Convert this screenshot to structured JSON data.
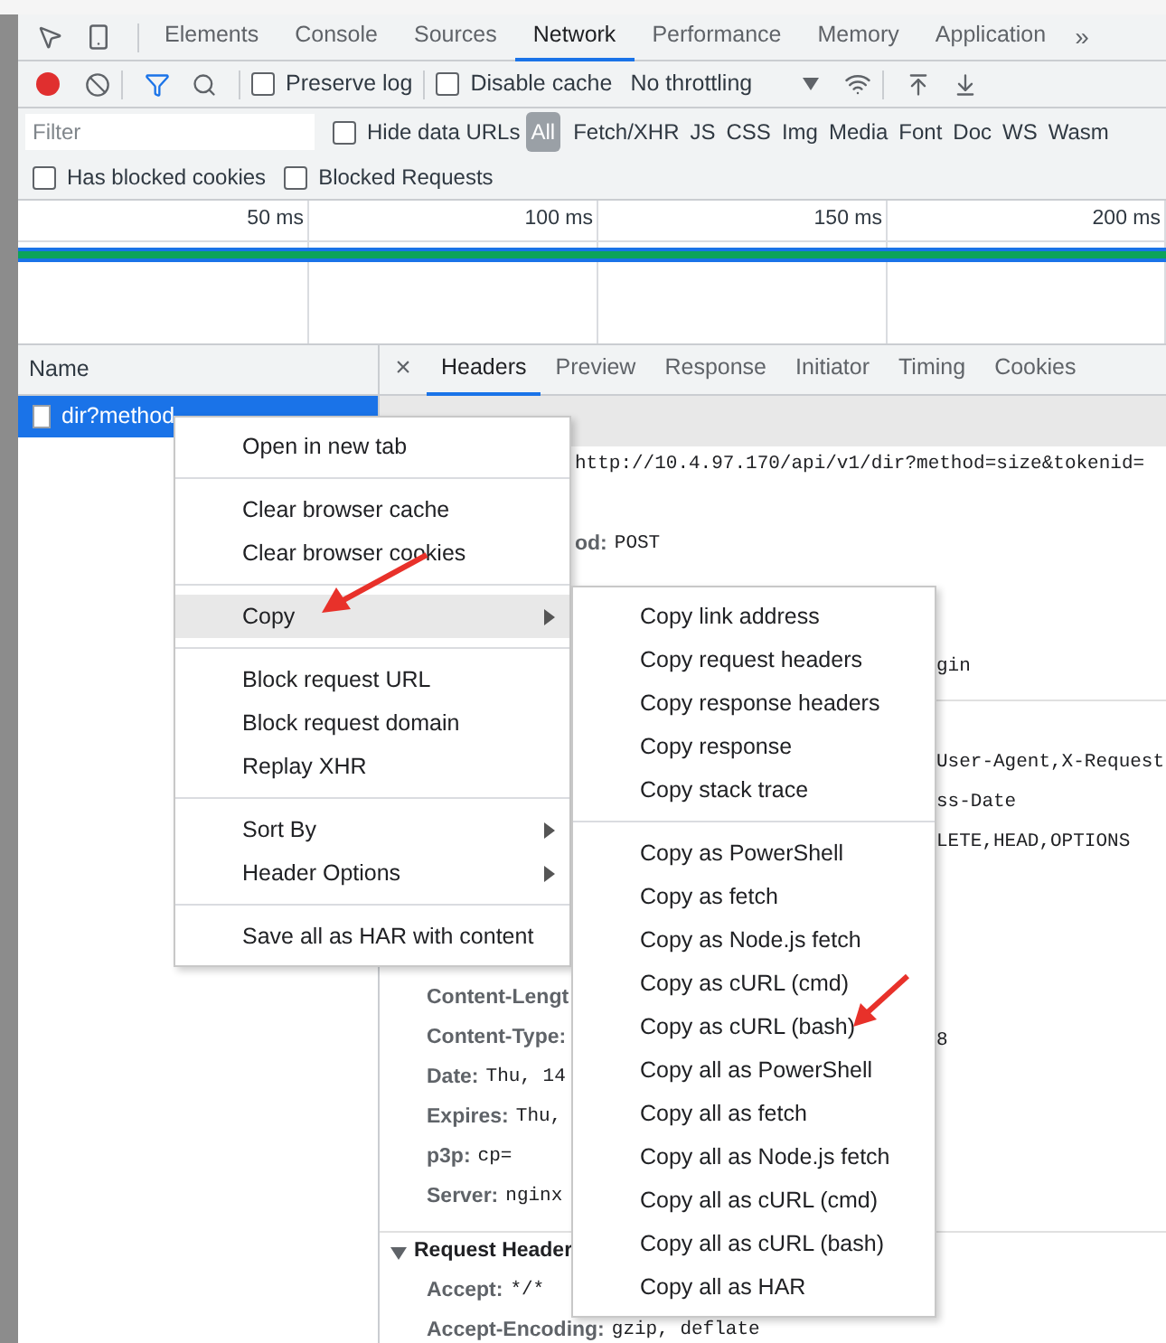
{
  "main_tabs": [
    {
      "label": "Elements",
      "selected": false
    },
    {
      "label": "Console",
      "selected": false
    },
    {
      "label": "Sources",
      "selected": false
    },
    {
      "label": "Network",
      "selected": true
    },
    {
      "label": "Performance",
      "selected": false
    },
    {
      "label": "Memory",
      "selected": false
    },
    {
      "label": "Application",
      "selected": false
    }
  ],
  "more_tabs": "»",
  "toolbar": {
    "recording": true,
    "preserve_log": {
      "label": "Preserve log",
      "checked": false
    },
    "disable_cache": {
      "label": "Disable cache",
      "checked": false
    },
    "throttling": "No throttling"
  },
  "filter": {
    "placeholder": "Filter",
    "hide_data_urls": {
      "label": "Hide data URLs",
      "checked": false
    },
    "types": [
      {
        "label": "All",
        "selected": true
      },
      {
        "label": "Fetch/XHR",
        "selected": false
      },
      {
        "label": "JS",
        "selected": false
      },
      {
        "label": "CSS",
        "selected": false
      },
      {
        "label": "Img",
        "selected": false
      },
      {
        "label": "Media",
        "selected": false
      },
      {
        "label": "Font",
        "selected": false
      },
      {
        "label": "Doc",
        "selected": false
      },
      {
        "label": "WS",
        "selected": false
      },
      {
        "label": "Wasm",
        "selected": false
      }
    ],
    "has_blocked_cookies": {
      "label": "Has blocked cookies",
      "checked": false
    },
    "blocked_requests": {
      "label": "Blocked Requests",
      "checked": false
    }
  },
  "timeline": {
    "ticks": [
      "50 ms",
      "100 ms",
      "150 ms",
      "200 ms"
    ]
  },
  "requests": {
    "column": "Name",
    "rows": [
      {
        "name": "dir?method",
        "selected": true
      }
    ]
  },
  "details": {
    "close": "×",
    "tabs": [
      {
        "label": "Headers",
        "selected": true
      },
      {
        "label": "Preview",
        "selected": false
      },
      {
        "label": "Response",
        "selected": false
      },
      {
        "label": "Initiator",
        "selected": false
      },
      {
        "label": "Timing",
        "selected": false
      },
      {
        "label": "Cookies",
        "selected": false
      }
    ],
    "general": [
      {
        "kind": "header",
        "value": "http://10.4.97.170/api/v1/dir?method=size&tokenid="
      },
      {
        "kind": "blank"
      },
      {
        "kind": "header",
        "name": "od:",
        "value": "POST"
      },
      {
        "kind": "blank"
      },
      {
        "kind": "blank"
      },
      {
        "kind": "header",
        "tail": "gin"
      }
    ],
    "response_headers": [
      {
        "kind": "blank"
      },
      {
        "kind": "header",
        "tail": "User-Agent,X-Request"
      },
      {
        "kind": "header",
        "tail": "ss-Date"
      },
      {
        "kind": "header",
        "tail": "LETE,HEAD,OPTIONS"
      },
      {
        "kind": "blank"
      },
      {
        "kind": "blank"
      },
      {
        "kind": "blank"
      },
      {
        "kind": "header",
        "name": "Content-Lengt"
      },
      {
        "kind": "header",
        "name": "Content-Type:",
        "tail": "8"
      },
      {
        "kind": "header",
        "name": "Date:",
        "value": "Thu, 14"
      },
      {
        "kind": "header",
        "name": "Expires:",
        "value": "Thu,"
      },
      {
        "kind": "header",
        "name": "p3p:",
        "value": "cp="
      },
      {
        "kind": "header",
        "name": "Server:",
        "value": "nginx"
      }
    ],
    "request_headers": {
      "title": "Request Header",
      "expanded": true,
      "lines": [
        {
          "kind": "header",
          "name": "Accept:",
          "value": "*/*"
        },
        {
          "kind": "header",
          "name": "Accept-Encoding:",
          "value": "gzip, deflate"
        }
      ]
    }
  },
  "context_menu": {
    "items": [
      {
        "kind": "item",
        "label": "Open in new tab",
        "highlighted": false,
        "submenu": false
      },
      {
        "kind": "separator"
      },
      {
        "kind": "item",
        "label": "Clear browser cache",
        "highlighted": false,
        "submenu": false
      },
      {
        "kind": "item",
        "label": "Clear browser cookies",
        "highlighted": false,
        "submenu": false
      },
      {
        "kind": "separator"
      },
      {
        "kind": "item",
        "label": "Copy",
        "highlighted": true,
        "submenu": true
      },
      {
        "kind": "separator"
      },
      {
        "kind": "item",
        "label": "Block request URL",
        "highlighted": false,
        "submenu": false
      },
      {
        "kind": "item",
        "label": "Block request domain",
        "highlighted": false,
        "submenu": false
      },
      {
        "kind": "item",
        "label": "Replay XHR",
        "highlighted": false,
        "submenu": false
      },
      {
        "kind": "separator"
      },
      {
        "kind": "item",
        "label": "Sort By",
        "highlighted": false,
        "submenu": true
      },
      {
        "kind": "item",
        "label": "Header Options",
        "highlighted": false,
        "submenu": true
      },
      {
        "kind": "separator"
      },
      {
        "kind": "item",
        "label": "Save all as HAR with content",
        "highlighted": false,
        "submenu": false
      }
    ]
  },
  "copy_submenu": {
    "items": [
      {
        "kind": "item",
        "label": "Copy link address"
      },
      {
        "kind": "item",
        "label": "Copy request headers"
      },
      {
        "kind": "item",
        "label": "Copy response headers"
      },
      {
        "kind": "item",
        "label": "Copy response"
      },
      {
        "kind": "item",
        "label": "Copy stack trace"
      },
      {
        "kind": "separator"
      },
      {
        "kind": "item",
        "label": "Copy as PowerShell"
      },
      {
        "kind": "item",
        "label": "Copy as fetch"
      },
      {
        "kind": "item",
        "label": "Copy as Node.js fetch"
      },
      {
        "kind": "item",
        "label": "Copy as cURL (cmd)"
      },
      {
        "kind": "item",
        "label": "Copy as cURL (bash)"
      },
      {
        "kind": "item",
        "label": "Copy all as PowerShell"
      },
      {
        "kind": "item",
        "label": "Copy all as fetch"
      },
      {
        "kind": "item",
        "label": "Copy all as Node.js fetch"
      },
      {
        "kind": "item",
        "label": "Copy all as cURL (cmd)"
      },
      {
        "kind": "item",
        "label": "Copy all as cURL (bash)"
      },
      {
        "kind": "item",
        "label": "Copy all as HAR"
      }
    ]
  }
}
